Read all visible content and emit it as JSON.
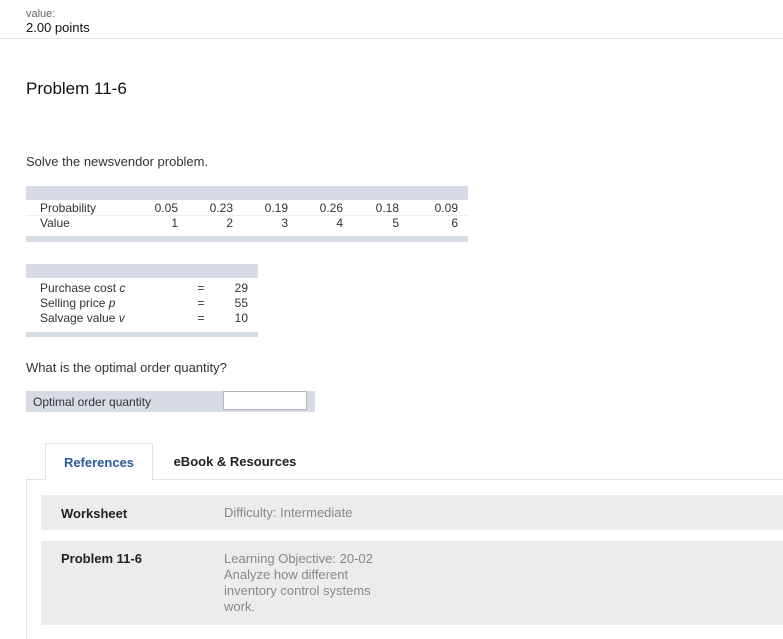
{
  "header": {
    "value_label": "value:",
    "value_points": "2.00 points"
  },
  "problem": {
    "title": "Problem 11-6",
    "instruction": "Solve the newsvendor problem."
  },
  "prob_table": {
    "prob_label": "Probability",
    "value_label": "Value",
    "probabilities": [
      "0.05",
      "0.23",
      "0.19",
      "0.26",
      "0.18",
      "0.09"
    ],
    "values": [
      "1",
      "2",
      "3",
      "4",
      "5",
      "6"
    ]
  },
  "cost_table": {
    "rows": [
      {
        "label": "Purchase cost",
        "symbol": "c",
        "eq": "=",
        "value": "29"
      },
      {
        "label": "Selling price",
        "symbol": "p",
        "eq": "=",
        "value": "55"
      },
      {
        "label": "Salvage value",
        "symbol": "v",
        "eq": "=",
        "value": "10"
      }
    ]
  },
  "question": "What is the optimal order quantity?",
  "answer": {
    "label": "Optimal order quantity",
    "value": ""
  },
  "tabs": [
    {
      "label": "References",
      "active": true
    },
    {
      "label": "eBook & Resources",
      "active": false
    }
  ],
  "references": {
    "rows": [
      {
        "title": "Worksheet",
        "meta": [
          "Difficulty: Intermediate"
        ]
      },
      {
        "title": "Problem 11-6",
        "meta": [
          "Learning Objective: 20-02",
          "Analyze how different",
          "inventory control systems",
          "work."
        ]
      }
    ]
  },
  "colors": {
    "table_bar": "#d6dbe6",
    "tab_active_text": "#2a5a9b",
    "ref_row_bg": "#ececec"
  }
}
